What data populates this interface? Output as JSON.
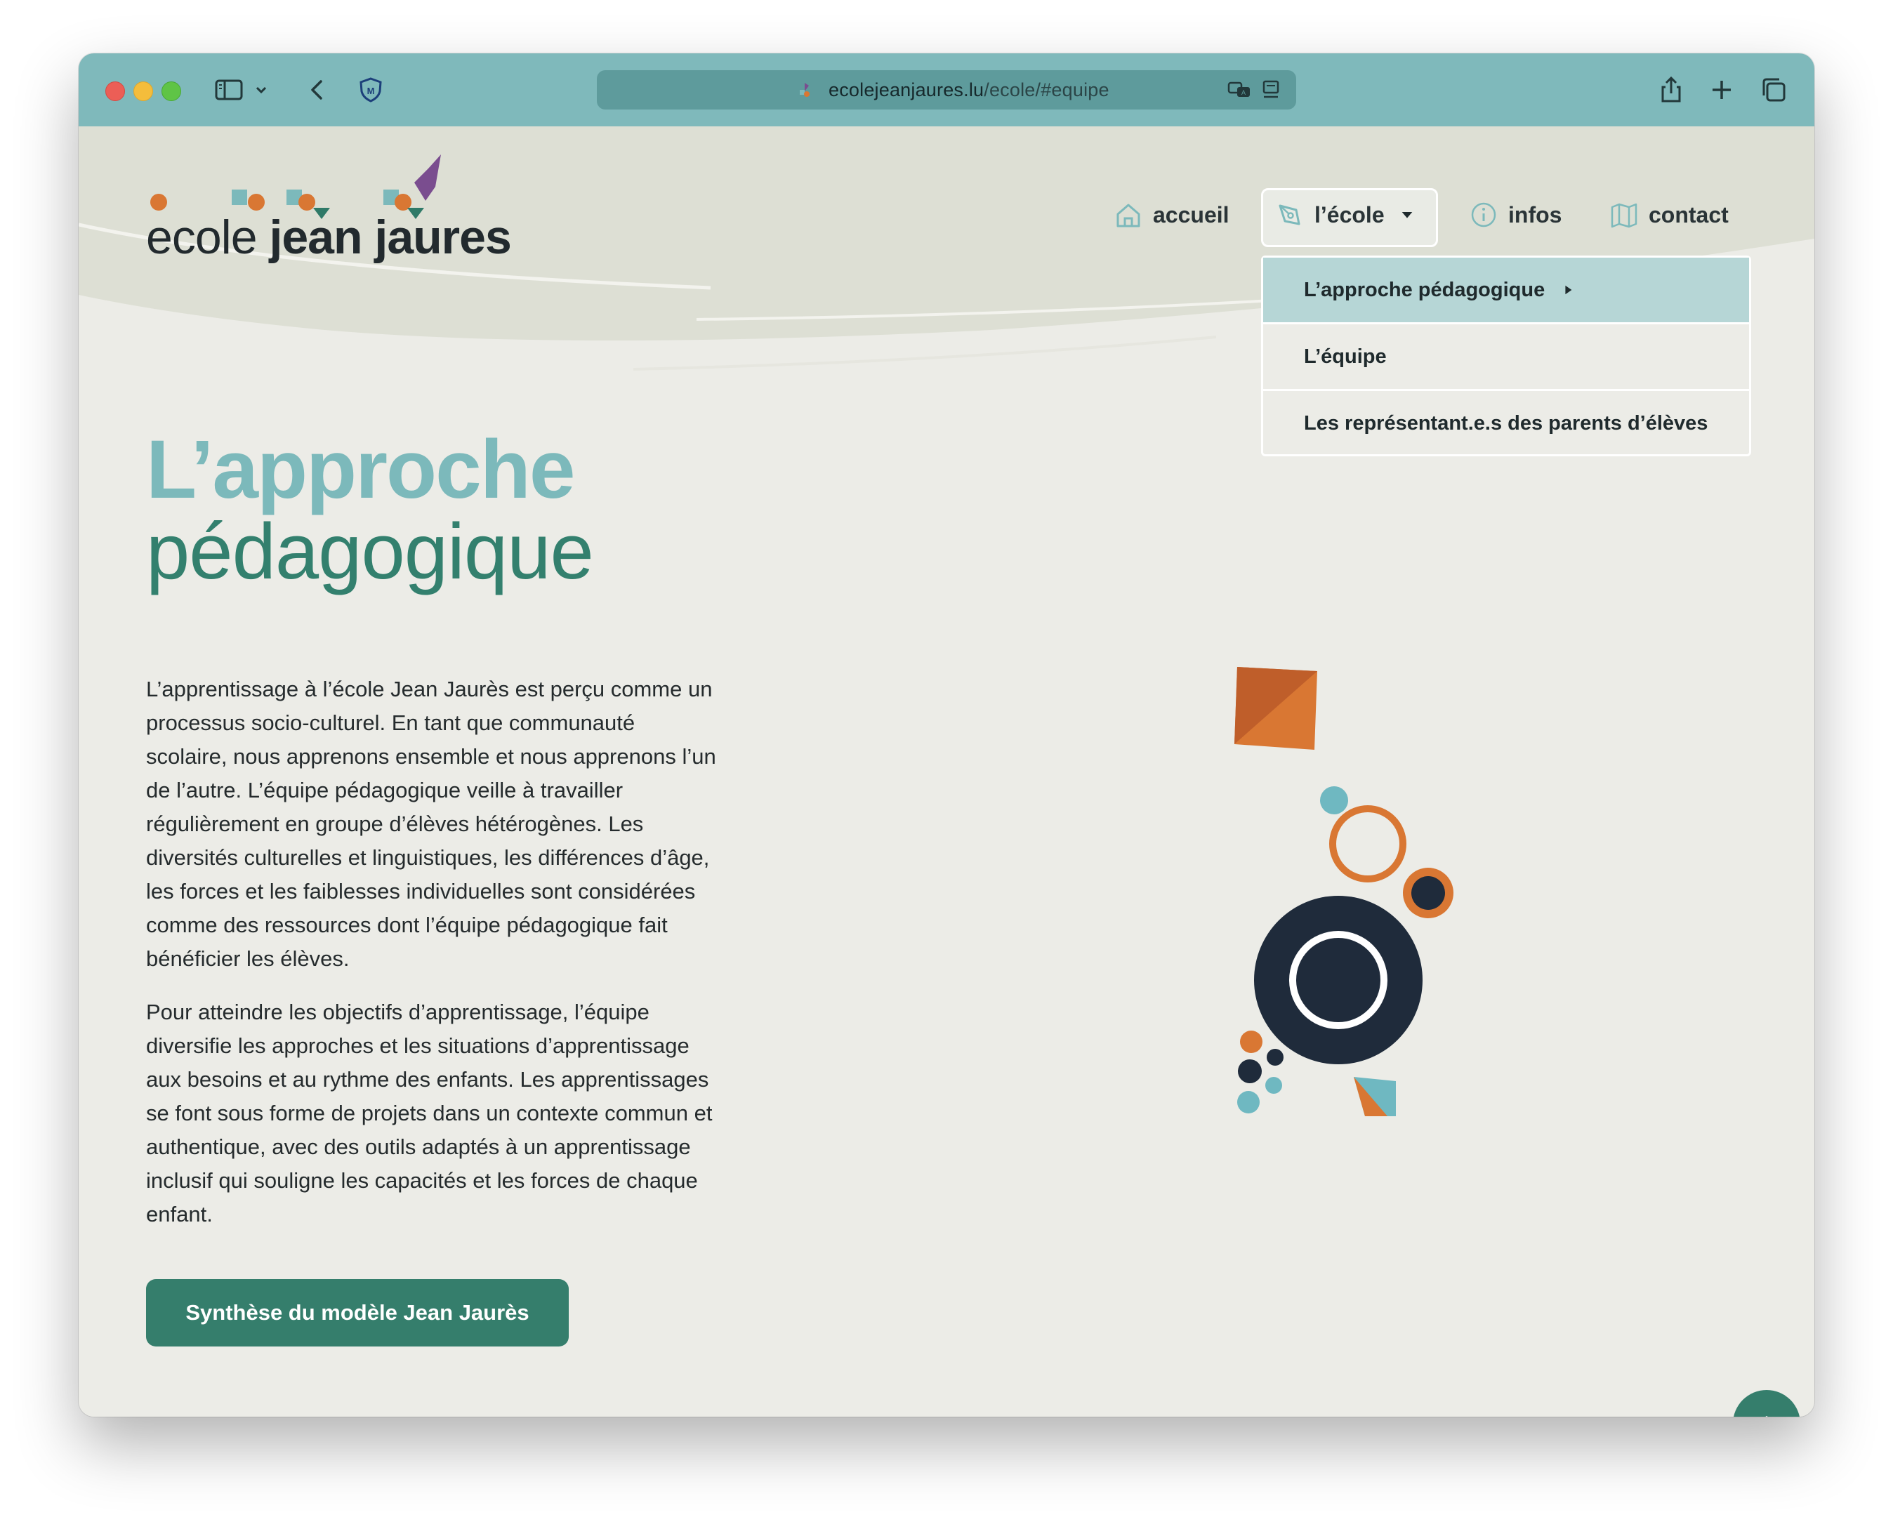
{
  "browser": {
    "url_domain": "ecolejeanjaures.lu",
    "url_path": "/ecole/#equipe",
    "colors": {
      "toolbar": "#7fb9bb",
      "url_bar": "#5e9b9c"
    }
  },
  "site": {
    "logo": {
      "part1": "ecole ",
      "part2": "jean jaures"
    },
    "nav": {
      "home": "accueil",
      "school": "l’école",
      "info": "infos",
      "contact": "contact"
    },
    "dropdown": [
      {
        "label": "L’approche pédagogique"
      },
      {
        "label": "L’équipe"
      },
      {
        "label": "Les représentant.e.s des parents d’élèves"
      }
    ]
  },
  "content": {
    "title_line1": "L’approche",
    "title_line2": "pédagogique",
    "paragraph1": "L’apprentissage à l’école Jean Jaurès est perçu comme un processus socio-culturel. En tant que communauté scolaire, nous apprenons ensemble et nous apprenons l’un de l’autre. L’équipe pédagogique veille à travailler régulièrement en groupe d’élèves hétérogènes. Les diversités culturelles et linguistiques, les différences d’âge, les forces et les faiblesses individuelles sont considérées comme des ressources dont l’équipe pédagogique fait bénéficier les élèves.",
    "paragraph2": "Pour atteindre les objectifs d’apprentissage, l’équipe diversifie les approches et les situations d’apprentissage aux besoins et au rythme des enfants. Les apprentissages se font sous forme de projets dans un contexte commun et authentique, avec des outils adaptés à un apprentissage inclusif qui souligne les capacités et les forces de chaque enfant.",
    "cta": "Synthèse du modèle Jean Jaurès"
  },
  "colors": {
    "accent_teal": "#7cb9bb",
    "accent_green": "#357e6c",
    "orange": "#d97733",
    "navy": "#1f2b3b"
  }
}
